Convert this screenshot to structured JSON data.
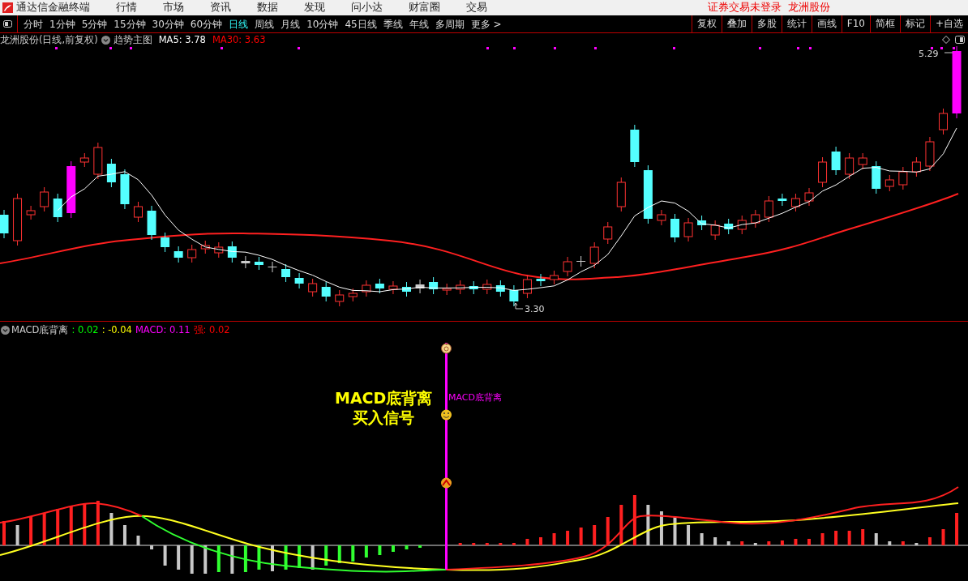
{
  "app": {
    "title": "通达信金融终端",
    "menu": [
      "行情",
      "市场",
      "资讯",
      "数据",
      "发现",
      "问小达",
      "财富圈",
      "交易"
    ],
    "login_status": "证券交易未登录",
    "stock": "龙洲股份"
  },
  "periods": [
    {
      "label": "分时",
      "selected": false
    },
    {
      "label": "1分钟",
      "selected": false
    },
    {
      "label": "5分钟",
      "selected": false
    },
    {
      "label": "15分钟",
      "selected": false
    },
    {
      "label": "30分钟",
      "selected": false
    },
    {
      "label": "60分钟",
      "selected": false
    },
    {
      "label": "日线",
      "selected": true
    },
    {
      "label": "周线",
      "selected": false
    },
    {
      "label": "月线",
      "selected": false
    },
    {
      "label": "10分钟",
      "selected": false
    },
    {
      "label": "45日线",
      "selected": false
    },
    {
      "label": "季线",
      "selected": false
    },
    {
      "label": "年线",
      "selected": false
    },
    {
      "label": "多周期",
      "selected": false
    },
    {
      "label": "更多 >",
      "selected": false
    }
  ],
  "tools": [
    "复权",
    "叠加",
    "多股",
    "统计",
    "画线",
    "F10",
    "简框",
    "标记",
    "+自选"
  ],
  "main_chart": {
    "title": "龙洲股份(日线,前复权)",
    "indicator": "趋势主图",
    "ma": [
      {
        "label": "MA5: 3.78",
        "color": "#ffffff"
      },
      {
        "label": "MA30: 3.63",
        "color": "#ff0000"
      }
    ],
    "high_label": "5.29",
    "low_label": "3.30"
  },
  "macd": {
    "title": "MACD底背离",
    "values": [
      {
        "label": ": 0.02",
        "color": "#00ff00"
      },
      {
        "label": ": -0.04",
        "color": "#ffff00"
      },
      {
        "label": "MACD: 0.11",
        "color": "#ff00ff"
      },
      {
        "label": "强: 0.02",
        "color": "#ff0000"
      }
    ],
    "signal_label": "MACD底背离",
    "annotation": [
      "MACD底背离",
      "买入信号"
    ]
  }
}
